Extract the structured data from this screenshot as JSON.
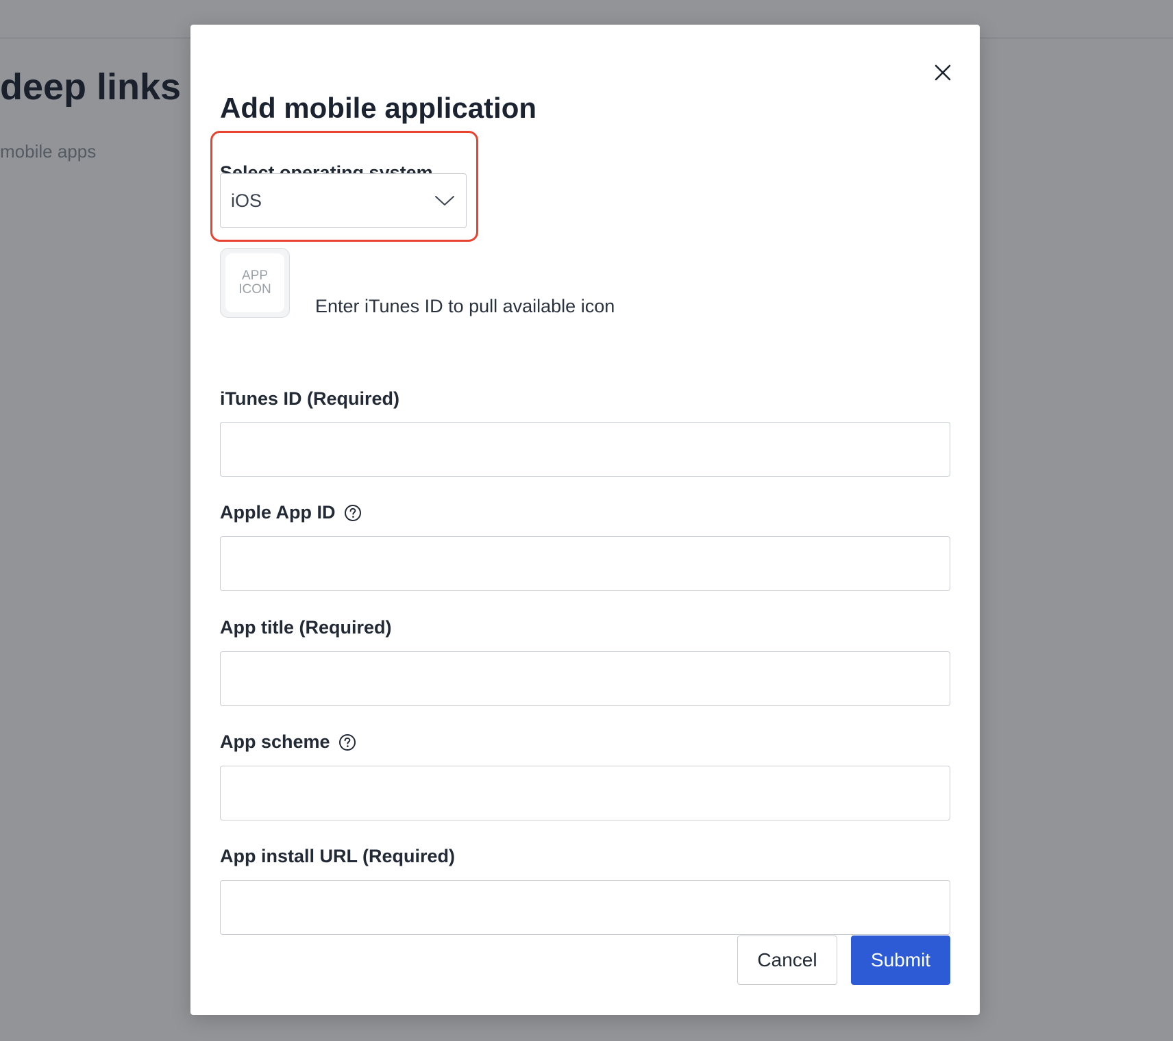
{
  "background": {
    "title": "deep links",
    "subtitle": "mobile apps"
  },
  "modal": {
    "title": "Add mobile application",
    "os_select": {
      "label": "Select operating system",
      "value": "iOS"
    },
    "app_icon": {
      "line1": "APP",
      "line2": "ICON",
      "hint": "Enter iTunes ID to pull available icon"
    },
    "fields": {
      "itunes_id": {
        "label": "iTunes ID (Required)",
        "value": ""
      },
      "apple_app_id": {
        "label": "Apple App ID",
        "value": ""
      },
      "app_title": {
        "label": "App title (Required)",
        "value": ""
      },
      "app_scheme": {
        "label": "App scheme",
        "value": ""
      },
      "app_install_url": {
        "label": "App install URL (Required)",
        "value": ""
      }
    },
    "buttons": {
      "cancel": "Cancel",
      "submit": "Submit"
    }
  },
  "colors": {
    "highlight": "#e8432e",
    "primary": "#2d5bd6",
    "heading": "#1b2330"
  },
  "icons": {
    "close": "close-icon",
    "dropdown": "chevron-down-icon",
    "help": "help-circle-icon"
  }
}
